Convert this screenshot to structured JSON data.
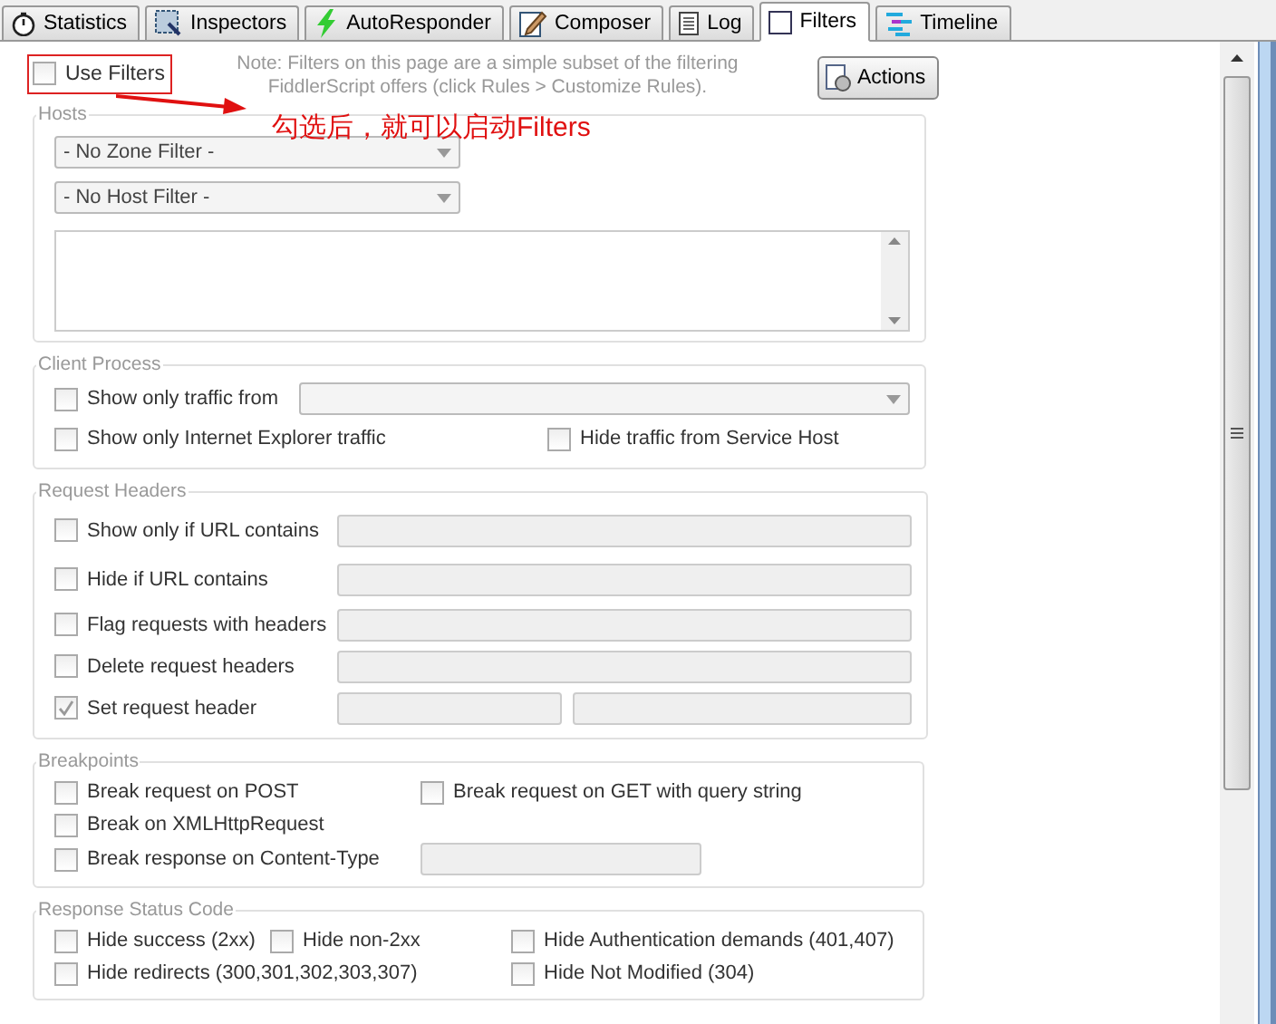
{
  "tabs": [
    {
      "label": "Statistics",
      "selected": false
    },
    {
      "label": "Inspectors",
      "selected": false
    },
    {
      "label": "AutoResponder",
      "selected": false
    },
    {
      "label": "Composer",
      "selected": false
    },
    {
      "label": "Log",
      "selected": false
    },
    {
      "label": "Filters",
      "selected": true
    },
    {
      "label": "Timeline",
      "selected": false
    }
  ],
  "use_filters": {
    "label": "Use Filters",
    "checked": false
  },
  "note": "Note: Filters on this page are a simple subset of the filtering FiddlerScript offers (click Rules > Customize Rules).",
  "actions_button": "Actions",
  "annotation": "勾选后，就可以启动Filters",
  "hosts": {
    "title": "Hosts",
    "zone_filter": "- No Zone Filter -",
    "host_filter": "- No Host Filter -"
  },
  "client_process": {
    "title": "Client Process",
    "traffic_from": {
      "label": "Show only traffic from",
      "checked": false
    },
    "ie_only": {
      "label": "Show only Internet Explorer traffic",
      "checked": false
    },
    "service_host": {
      "label": "Hide traffic from Service Host",
      "checked": false
    }
  },
  "request_headers": {
    "title": "Request Headers",
    "rows": [
      {
        "label": "Show only if URL contains",
        "checked": false,
        "kind": "single"
      },
      {
        "label": "Hide if URL contains",
        "checked": false,
        "kind": "single"
      },
      {
        "label": "Flag requests with headers",
        "checked": false,
        "kind": "single"
      },
      {
        "label": "Delete request headers",
        "checked": false,
        "kind": "single"
      },
      {
        "label": "Set request header",
        "checked": true,
        "kind": "pair"
      }
    ]
  },
  "breakpoints": {
    "title": "Breakpoints",
    "post": {
      "label": "Break request on POST",
      "checked": false
    },
    "get_query": {
      "label": "Break request on GET with query string",
      "checked": false
    },
    "xhr": {
      "label": "Break on XMLHttpRequest",
      "checked": false
    },
    "content_type": {
      "label": "Break response on Content-Type",
      "checked": false
    }
  },
  "response_status": {
    "title": "Response Status Code",
    "success": {
      "label": "Hide success (2xx)",
      "checked": false
    },
    "non2xx": {
      "label": "Hide non-2xx",
      "checked": false
    },
    "auth": {
      "label": "Hide Authentication demands (401,407)",
      "checked": false
    },
    "redirects": {
      "label": "Hide redirects (300,301,302,303,307)",
      "checked": false
    },
    "not_modified": {
      "label": "Hide Not Modified (304)",
      "checked": false
    }
  }
}
